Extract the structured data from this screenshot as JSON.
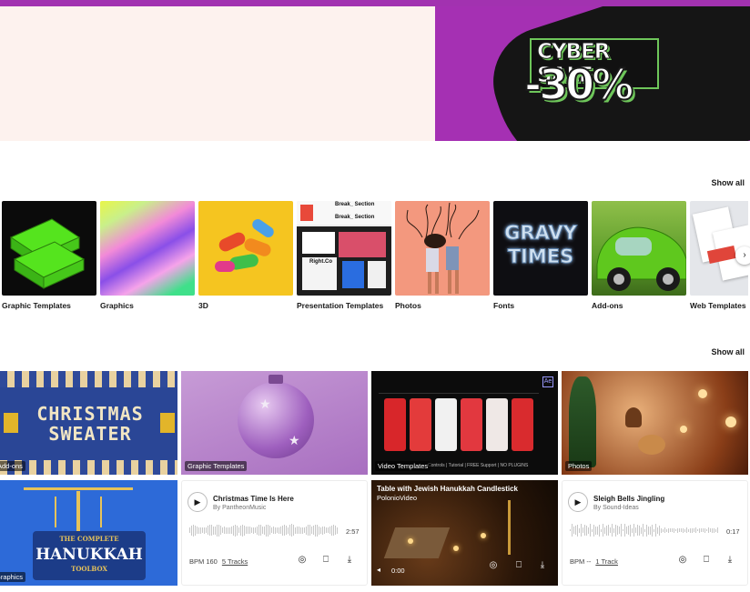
{
  "banner": {
    "sale_top": "CYBER SALE",
    "sale_pct": "-30%"
  },
  "sections": {
    "show_all_1": "Show all",
    "show_all_2": "Show all"
  },
  "categories": [
    {
      "label": "Graphic Templates"
    },
    {
      "label": "Graphics"
    },
    {
      "label": "3D"
    },
    {
      "label": "Presentation Templates"
    },
    {
      "label": "Photos"
    },
    {
      "label": "Fonts"
    },
    {
      "label": "Add-ons"
    },
    {
      "label": "Web Templates"
    }
  ],
  "thumb_text": {
    "break_section_1": "Break_ Section",
    "break_section_2": "Break_ Section",
    "right_co": "Right.Co",
    "fonts_art": "GRAVY TIMES",
    "christmas_1": "CHRISTMAS",
    "christmas_2": "SWEATER",
    "hanukkah_1": "THE COMPLETE",
    "hanukkah_2": "HANUKKAH",
    "hanukkah_3": "TOOLBOX",
    "video_ae": "Ae",
    "video_strip": "Controls | Tutorial | FREE Support | NO PLUGINS"
  },
  "grid": {
    "tiles": [
      {
        "tag": "Add-ons"
      },
      {
        "tag": "Graphic Templates"
      },
      {
        "tag": "Video Templates"
      },
      {
        "tag": "Photos"
      },
      {
        "tag": "Graphics"
      }
    ],
    "audio": [
      {
        "title": "Christmas Time Is Here",
        "author": "By PantheonMusic",
        "duration": "2:57",
        "bpm": "BPM 160",
        "tracks": "5 Tracks"
      },
      {
        "title": "Sleigh Bells Jingling",
        "author": "By Sound-Ideas",
        "duration": "0:17",
        "bpm": "BPM --",
        "tracks": "1 Track"
      }
    ],
    "video": {
      "title": "Table with Jewish Hanukkah Candlestick",
      "author": "PolonioVideo",
      "time": "0:00"
    }
  },
  "icons": {
    "play": "▶",
    "similar": "◎",
    "bookmark": "⎕",
    "download": "⤓",
    "next": "›"
  }
}
